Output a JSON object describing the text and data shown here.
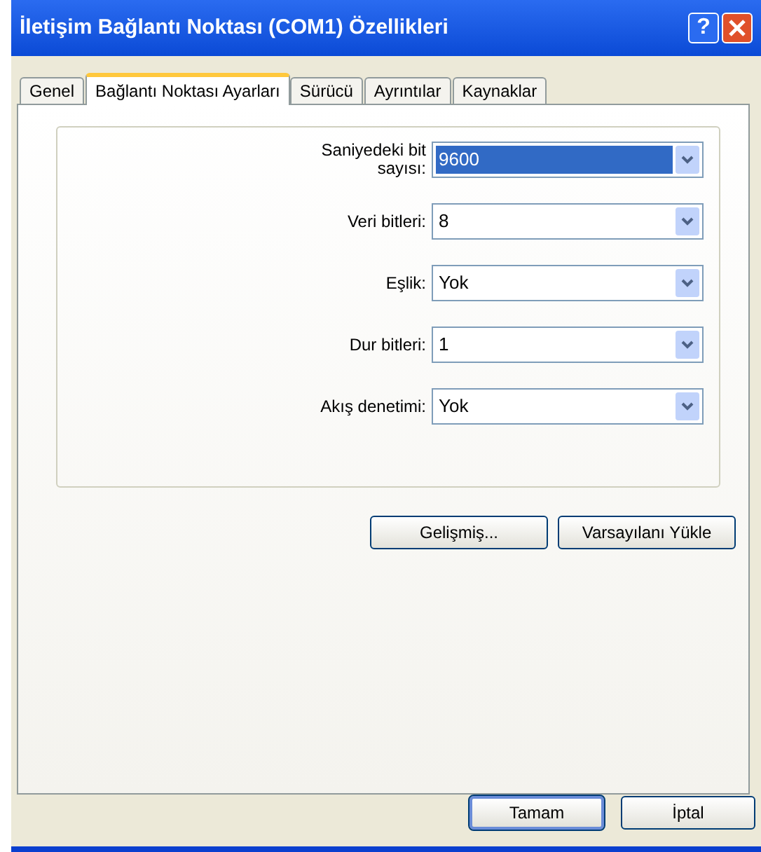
{
  "window": {
    "title": "İletişim Bağlantı Noktası (COM1) Özellikleri",
    "help_button": "?"
  },
  "tabs": [
    {
      "label": "Genel",
      "selected": false
    },
    {
      "label": "Bağlantı Noktası Ayarları",
      "selected": true
    },
    {
      "label": "Sürücü",
      "selected": false
    },
    {
      "label": "Ayrıntılar",
      "selected": false
    },
    {
      "label": "Kaynaklar",
      "selected": false
    }
  ],
  "settings": [
    {
      "label": "Saniyedeki bit sayısı:",
      "value": "9600",
      "selected": true
    },
    {
      "label": "Veri bitleri:",
      "value": "8",
      "selected": false
    },
    {
      "label": "Eşlik:",
      "value": "Yok",
      "selected": false
    },
    {
      "label": "Dur bitleri:",
      "value": "1",
      "selected": false
    },
    {
      "label": "Akış denetimi:",
      "value": "Yok",
      "selected": false
    }
  ],
  "panel_buttons": [
    "Gelişmiş...",
    "Varsayılanı Yükle"
  ],
  "dialog_buttons": [
    {
      "label": "Tamam",
      "default": true
    },
    {
      "label": "İptal",
      "default": false
    }
  ]
}
